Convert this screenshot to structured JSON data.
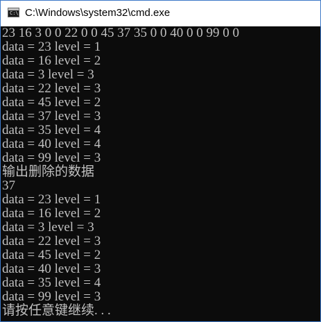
{
  "window": {
    "title": "C:\\Windows\\system32\\cmd.exe",
    "icon": "cmd-icon",
    "icon_prompt": "C:\\"
  },
  "console": {
    "lines": [
      "23 16 3 0 0 22 0 0 45 37 35 0 0 40 0 0 99 0 0",
      "data = 23 level = 1",
      "data = 16 level = 2",
      "data = 3 level = 3",
      "data = 22 level = 3",
      "data = 45 level = 2",
      "data = 37 level = 3",
      "data = 35 level = 4",
      "data = 40 level = 4",
      "data = 99 level = 3",
      "输出删除的数据",
      "37",
      "data = 23 level = 1",
      "data = 16 level = 2",
      "data = 3 level = 3",
      "data = 22 level = 3",
      "data = 45 level = 2",
      "data = 40 level = 3",
      "data = 35 level = 4",
      "data = 99 level = 3",
      "请按任意键继续. . ."
    ]
  },
  "colors": {
    "console_background": "#0c0c0c",
    "console_text": "#c0c0c0",
    "titlebar_background": "#ffffff",
    "window_border": "#3c78c8"
  }
}
